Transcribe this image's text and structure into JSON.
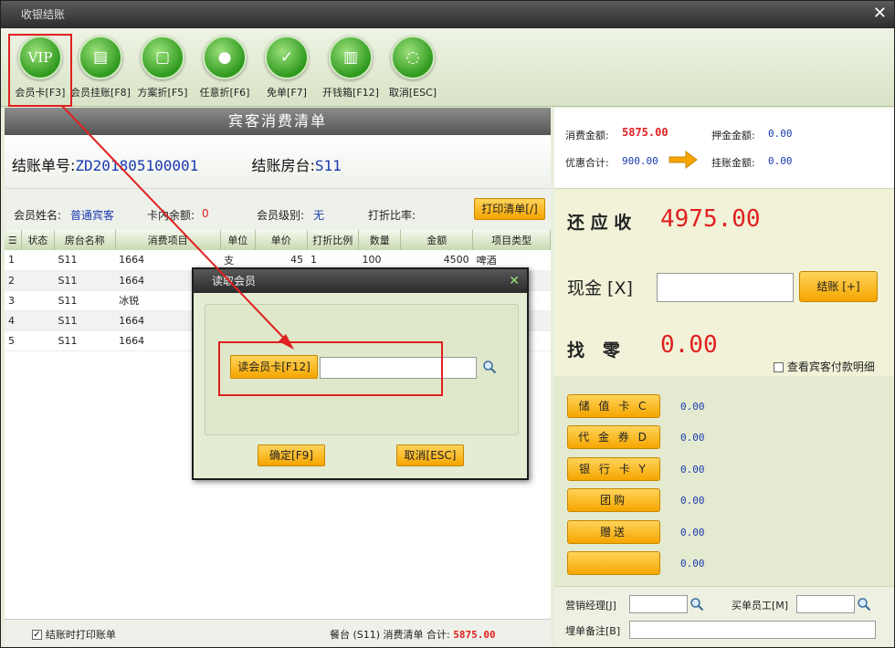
{
  "window": {
    "title": "收银结账"
  },
  "toolbar": [
    {
      "icon": "vip-card-icon",
      "glyph": "VIP",
      "label": "会员卡[F3]"
    },
    {
      "icon": "member-charge-icon",
      "glyph": "▤",
      "label": "会员挂账[F8]"
    },
    {
      "icon": "plan-discount-icon",
      "glyph": "▢",
      "label": "方案折[F5]"
    },
    {
      "icon": "any-discount-icon",
      "glyph": "●",
      "label": "任意折[F6]"
    },
    {
      "icon": "free-bill-icon",
      "glyph": "✓",
      "label": "免单[F7]"
    },
    {
      "icon": "cash-drawer-icon",
      "glyph": "▥",
      "label": "开钱箱[F12]"
    },
    {
      "icon": "cancel-icon",
      "glyph": "◌",
      "label": "取消[ESC]"
    }
  ],
  "bill": {
    "list_title": "宾客消费清单",
    "bill_no_label": "结账单号:",
    "bill_no": "ZD201805100001",
    "room_label": "结账房台:",
    "room": "S11"
  },
  "member": {
    "name_label": "会员姓名:",
    "name": "普通宾客",
    "balance_label": "卡内余额:",
    "balance": "0",
    "level_label": "会员级别:",
    "level": "无",
    "discount_label": "打折比率:",
    "print_button": "打印清单[/]"
  },
  "grid": {
    "columns": [
      "状态",
      "房台名称",
      "消费项目",
      "单位",
      "单价",
      "打折比例",
      "数量",
      "金额",
      "项目类型"
    ],
    "rows": [
      {
        "no": "1",
        "status": "",
        "room": "S11",
        "item": "1664",
        "unit": "支",
        "price": "45",
        "ratio": "1",
        "qty": "100",
        "amount": "4500",
        "type": "啤酒"
      },
      {
        "no": "2",
        "status": "",
        "room": "S11",
        "item": "1664",
        "unit": "",
        "price": "",
        "ratio": "",
        "qty": "",
        "amount": "",
        "type": ""
      },
      {
        "no": "3",
        "status": "",
        "room": "S11",
        "item": "冰锐",
        "unit": "",
        "price": "",
        "ratio": "",
        "qty": "",
        "amount": "",
        "type": ""
      },
      {
        "no": "4",
        "status": "",
        "room": "S11",
        "item": "1664",
        "unit": "",
        "price": "",
        "ratio": "",
        "qty": "",
        "amount": "",
        "type": ""
      },
      {
        "no": "5",
        "status": "",
        "room": "S11",
        "item": "1664",
        "unit": "",
        "price": "",
        "ratio": "",
        "qty": "",
        "amount": "",
        "type": ""
      }
    ]
  },
  "footer": {
    "print_on_checkout": "结账时打印账单",
    "summary_prefix": "餐台 (S11) 消费清单 合计:",
    "summary_total": "5875.00"
  },
  "summary": {
    "consume_label": "消费金额:",
    "consume": "5875.00",
    "deposit_label": "押金金额:",
    "deposit": "0.00",
    "discount_label": "优惠合计:",
    "discount": "900.00",
    "charge_label": "挂账金额:",
    "charge": "0.00"
  },
  "settle": {
    "due_label": "还 应 收",
    "due": "4975.00",
    "cash_label": "现金 [X]",
    "cash_value": "",
    "checkout_button": "结账 [+]",
    "change_label": "找   零",
    "change": "0.00",
    "detail_checkbox": "查看宾客付款明细"
  },
  "payments": [
    {
      "label": "储 值 卡 C",
      "value": "0.00"
    },
    {
      "label": "代 金 券 D",
      "value": "0.00"
    },
    {
      "label": "银 行 卡 Y",
      "value": "0.00"
    },
    {
      "label": "团购",
      "value": "0.00"
    },
    {
      "label": "赠送",
      "value": "0.00"
    },
    {
      "label": "",
      "value": "0.00"
    }
  ],
  "staff": {
    "manager_label": "营销经理[J]",
    "buyer_label": "买单员工[M]",
    "note_label": "埋单备注[B]"
  },
  "dialog": {
    "title": "读取会员",
    "read_button": "读会员卡[F12]",
    "card_value": "",
    "ok_button": "确定[F9]",
    "cancel_button": "取消[ESC]"
  },
  "colors": {
    "accent_red": "#e02020",
    "value_blue": "#1a3ab0",
    "button_orange": "#f5a500",
    "icon_green": "#2f9a1e"
  }
}
